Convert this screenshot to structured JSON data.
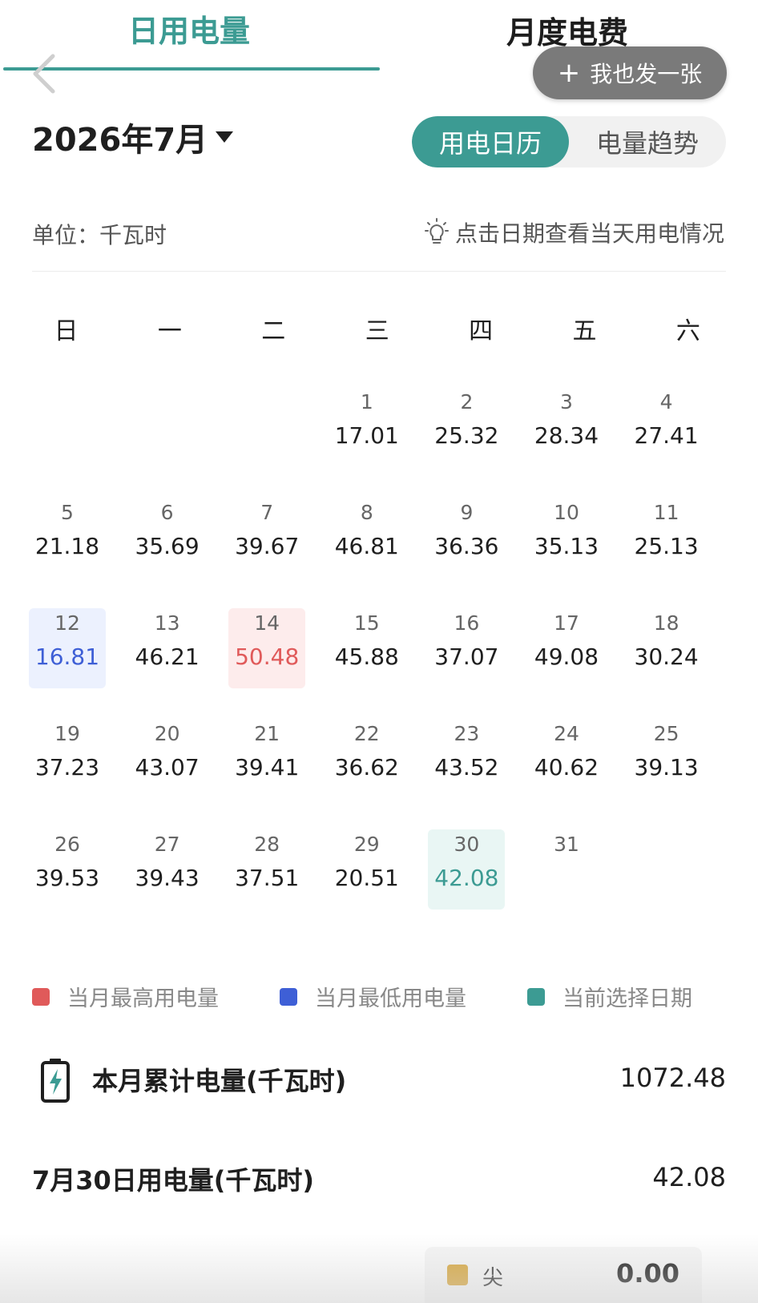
{
  "tabs": {
    "daily": "日用电量",
    "monthly": "月度电费"
  },
  "share_button": {
    "plus": "+",
    "label": "我也发一张"
  },
  "month_selector": {
    "label": "2026年7月"
  },
  "view_toggle": {
    "calendar": "用电日历",
    "trend": "电量趋势"
  },
  "unit_label": "单位：千瓦时",
  "hint": "点击日期查看当天用电情况",
  "weekdays": [
    "日",
    "一",
    "二",
    "三",
    "四",
    "五",
    "六"
  ],
  "calendar": {
    "first_weekday_index": 3,
    "days": [
      {
        "day": "1",
        "value": "17.01"
      },
      {
        "day": "2",
        "value": "25.32"
      },
      {
        "day": "3",
        "value": "28.34"
      },
      {
        "day": "4",
        "value": "27.41"
      },
      {
        "day": "5",
        "value": "21.18"
      },
      {
        "day": "6",
        "value": "35.69"
      },
      {
        "day": "7",
        "value": "39.67"
      },
      {
        "day": "8",
        "value": "46.81"
      },
      {
        "day": "9",
        "value": "36.36"
      },
      {
        "day": "10",
        "value": "35.13"
      },
      {
        "day": "11",
        "value": "25.13"
      },
      {
        "day": "12",
        "value": "16.81",
        "status": "low"
      },
      {
        "day": "13",
        "value": "46.21"
      },
      {
        "day": "14",
        "value": "50.48",
        "status": "high"
      },
      {
        "day": "15",
        "value": "45.88"
      },
      {
        "day": "16",
        "value": "37.07"
      },
      {
        "day": "17",
        "value": "49.08"
      },
      {
        "day": "18",
        "value": "30.24"
      },
      {
        "day": "19",
        "value": "37.23"
      },
      {
        "day": "20",
        "value": "43.07"
      },
      {
        "day": "21",
        "value": "39.41"
      },
      {
        "day": "22",
        "value": "36.62"
      },
      {
        "day": "23",
        "value": "43.52"
      },
      {
        "day": "24",
        "value": "40.62"
      },
      {
        "day": "25",
        "value": "39.13"
      },
      {
        "day": "26",
        "value": "39.53"
      },
      {
        "day": "27",
        "value": "39.43"
      },
      {
        "day": "28",
        "value": "37.51"
      },
      {
        "day": "29",
        "value": "20.51"
      },
      {
        "day": "30",
        "value": "42.08",
        "status": "selected"
      },
      {
        "day": "31",
        "value": ""
      }
    ]
  },
  "legend": {
    "high": "当月最高用电量",
    "low": "当月最低用电量",
    "selected": "当前选择日期"
  },
  "colors": {
    "accent": "#3c9b93",
    "high": "#e05a5a",
    "low": "#3e5fd6",
    "peak_swatch": "#d8a73e"
  },
  "monthly_total": {
    "label": "本月累计电量(千瓦时)",
    "value": "1072.48"
  },
  "day_total": {
    "label": "7月30日用电量(千瓦时)",
    "value": "42.08"
  },
  "tou": {
    "label": "尖",
    "value": "0.00"
  }
}
